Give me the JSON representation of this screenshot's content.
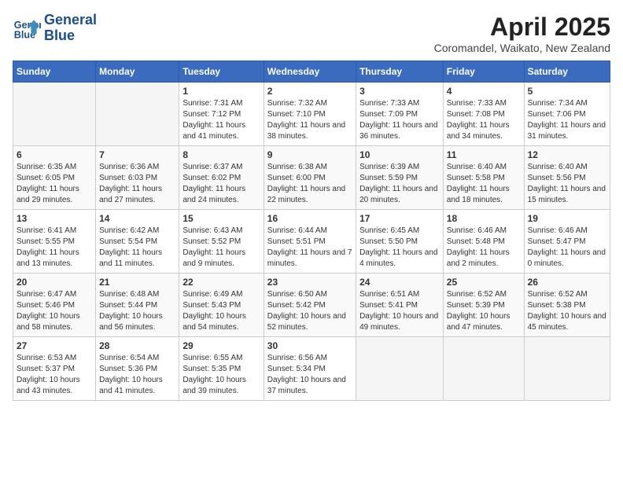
{
  "logo": {
    "line1": "General",
    "line2": "Blue"
  },
  "title": "April 2025",
  "subtitle": "Coromandel, Waikato, New Zealand",
  "days_of_week": [
    "Sunday",
    "Monday",
    "Tuesday",
    "Wednesday",
    "Thursday",
    "Friday",
    "Saturday"
  ],
  "weeks": [
    [
      {
        "day": "",
        "info": ""
      },
      {
        "day": "",
        "info": ""
      },
      {
        "day": "1",
        "info": "Sunrise: 7:31 AM\nSunset: 7:12 PM\nDaylight: 11 hours and 41 minutes."
      },
      {
        "day": "2",
        "info": "Sunrise: 7:32 AM\nSunset: 7:10 PM\nDaylight: 11 hours and 38 minutes."
      },
      {
        "day": "3",
        "info": "Sunrise: 7:33 AM\nSunset: 7:09 PM\nDaylight: 11 hours and 36 minutes."
      },
      {
        "day": "4",
        "info": "Sunrise: 7:33 AM\nSunset: 7:08 PM\nDaylight: 11 hours and 34 minutes."
      },
      {
        "day": "5",
        "info": "Sunrise: 7:34 AM\nSunset: 7:06 PM\nDaylight: 11 hours and 31 minutes."
      }
    ],
    [
      {
        "day": "6",
        "info": "Sunrise: 6:35 AM\nSunset: 6:05 PM\nDaylight: 11 hours and 29 minutes."
      },
      {
        "day": "7",
        "info": "Sunrise: 6:36 AM\nSunset: 6:03 PM\nDaylight: 11 hours and 27 minutes."
      },
      {
        "day": "8",
        "info": "Sunrise: 6:37 AM\nSunset: 6:02 PM\nDaylight: 11 hours and 24 minutes."
      },
      {
        "day": "9",
        "info": "Sunrise: 6:38 AM\nSunset: 6:00 PM\nDaylight: 11 hours and 22 minutes."
      },
      {
        "day": "10",
        "info": "Sunrise: 6:39 AM\nSunset: 5:59 PM\nDaylight: 11 hours and 20 minutes."
      },
      {
        "day": "11",
        "info": "Sunrise: 6:40 AM\nSunset: 5:58 PM\nDaylight: 11 hours and 18 minutes."
      },
      {
        "day": "12",
        "info": "Sunrise: 6:40 AM\nSunset: 5:56 PM\nDaylight: 11 hours and 15 minutes."
      }
    ],
    [
      {
        "day": "13",
        "info": "Sunrise: 6:41 AM\nSunset: 5:55 PM\nDaylight: 11 hours and 13 minutes."
      },
      {
        "day": "14",
        "info": "Sunrise: 6:42 AM\nSunset: 5:54 PM\nDaylight: 11 hours and 11 minutes."
      },
      {
        "day": "15",
        "info": "Sunrise: 6:43 AM\nSunset: 5:52 PM\nDaylight: 11 hours and 9 minutes."
      },
      {
        "day": "16",
        "info": "Sunrise: 6:44 AM\nSunset: 5:51 PM\nDaylight: 11 hours and 7 minutes."
      },
      {
        "day": "17",
        "info": "Sunrise: 6:45 AM\nSunset: 5:50 PM\nDaylight: 11 hours and 4 minutes."
      },
      {
        "day": "18",
        "info": "Sunrise: 6:46 AM\nSunset: 5:48 PM\nDaylight: 11 hours and 2 minutes."
      },
      {
        "day": "19",
        "info": "Sunrise: 6:46 AM\nSunset: 5:47 PM\nDaylight: 11 hours and 0 minutes."
      }
    ],
    [
      {
        "day": "20",
        "info": "Sunrise: 6:47 AM\nSunset: 5:46 PM\nDaylight: 10 hours and 58 minutes."
      },
      {
        "day": "21",
        "info": "Sunrise: 6:48 AM\nSunset: 5:44 PM\nDaylight: 10 hours and 56 minutes."
      },
      {
        "day": "22",
        "info": "Sunrise: 6:49 AM\nSunset: 5:43 PM\nDaylight: 10 hours and 54 minutes."
      },
      {
        "day": "23",
        "info": "Sunrise: 6:50 AM\nSunset: 5:42 PM\nDaylight: 10 hours and 52 minutes."
      },
      {
        "day": "24",
        "info": "Sunrise: 6:51 AM\nSunset: 5:41 PM\nDaylight: 10 hours and 49 minutes."
      },
      {
        "day": "25",
        "info": "Sunrise: 6:52 AM\nSunset: 5:39 PM\nDaylight: 10 hours and 47 minutes."
      },
      {
        "day": "26",
        "info": "Sunrise: 6:52 AM\nSunset: 5:38 PM\nDaylight: 10 hours and 45 minutes."
      }
    ],
    [
      {
        "day": "27",
        "info": "Sunrise: 6:53 AM\nSunset: 5:37 PM\nDaylight: 10 hours and 43 minutes."
      },
      {
        "day": "28",
        "info": "Sunrise: 6:54 AM\nSunset: 5:36 PM\nDaylight: 10 hours and 41 minutes."
      },
      {
        "day": "29",
        "info": "Sunrise: 6:55 AM\nSunset: 5:35 PM\nDaylight: 10 hours and 39 minutes."
      },
      {
        "day": "30",
        "info": "Sunrise: 6:56 AM\nSunset: 5:34 PM\nDaylight: 10 hours and 37 minutes."
      },
      {
        "day": "",
        "info": ""
      },
      {
        "day": "",
        "info": ""
      },
      {
        "day": "",
        "info": ""
      }
    ]
  ]
}
